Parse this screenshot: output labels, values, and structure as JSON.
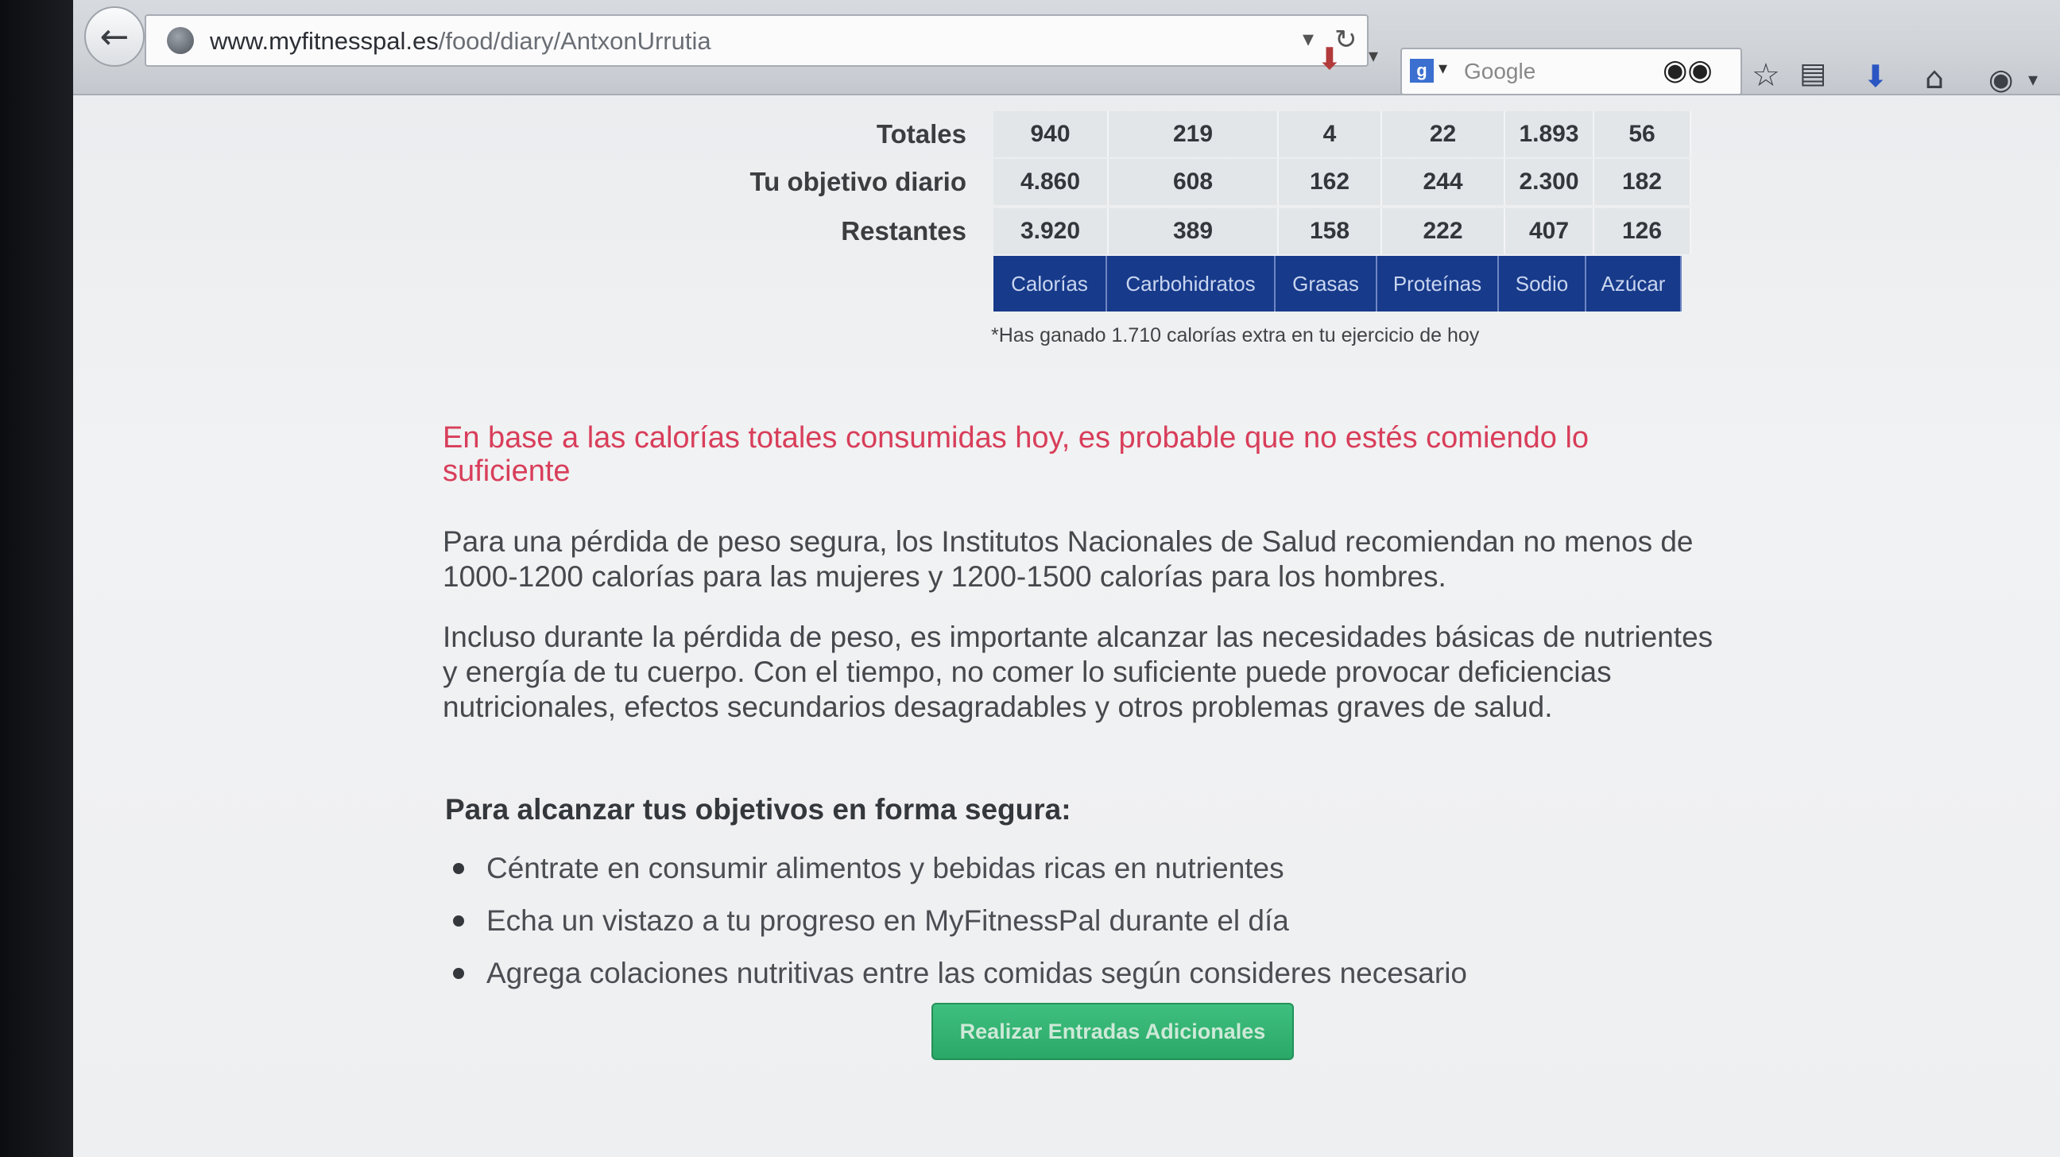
{
  "browser": {
    "url_host": "www.myfitnesspal.es",
    "url_path": "/food/diary/AntxonUrrutia",
    "search_placeholder": "Google",
    "search_engine_label": "g"
  },
  "summary": {
    "rows": [
      {
        "label": "Totales",
        "values": [
          "940",
          "219",
          "4",
          "22",
          "1.893",
          "56"
        ]
      },
      {
        "label": "Tu objetivo diario",
        "values": [
          "4.860",
          "608",
          "162",
          "244",
          "2.300",
          "182"
        ]
      },
      {
        "label": "Restantes",
        "values": [
          "3.920",
          "389",
          "158",
          "222",
          "407",
          "126"
        ]
      }
    ],
    "columns": [
      "Calorías",
      "Carbohidratos",
      "Grasas",
      "Proteínas",
      "Sodio",
      "Azúcar"
    ],
    "extra_note": "*Has ganado 1.710 calorías extra en tu ejercicio de hoy"
  },
  "warning": "En base a las calorías totales consumidas hoy, es probable que no estés comiendo lo suficiente",
  "paragraphs": [
    "Para una pérdida de peso segura, los Institutos Nacionales de Salud recomiendan no menos de 1000-1200 calorías para las mujeres y 1200-1500 calorías para los hombres.",
    "Incluso durante la pérdida de peso, es importante alcanzar las necesidades básicas de nutrientes y energía de tu cuerpo. Con el tiempo, no comer lo suficiente puede provocar deficiencias nutricionales, efectos secundarios desagradables y otros problemas graves de salud."
  ],
  "subheading": "Para alcanzar tus objetivos en forma segura:",
  "tips": [
    "Céntrate en consumir alimentos y bebidas ricas en nutrientes",
    "Echa un vistazo a tu progreso en MyFitnessPal durante el día",
    "Agrega colaciones nutritivas entre las comidas según consideres necesario"
  ],
  "cta_label": "Realizar Entradas Adicionales",
  "colors": {
    "tab_bg": "#173a8a",
    "warning": "#d83e5a",
    "cta_bg": "#2aa868"
  }
}
